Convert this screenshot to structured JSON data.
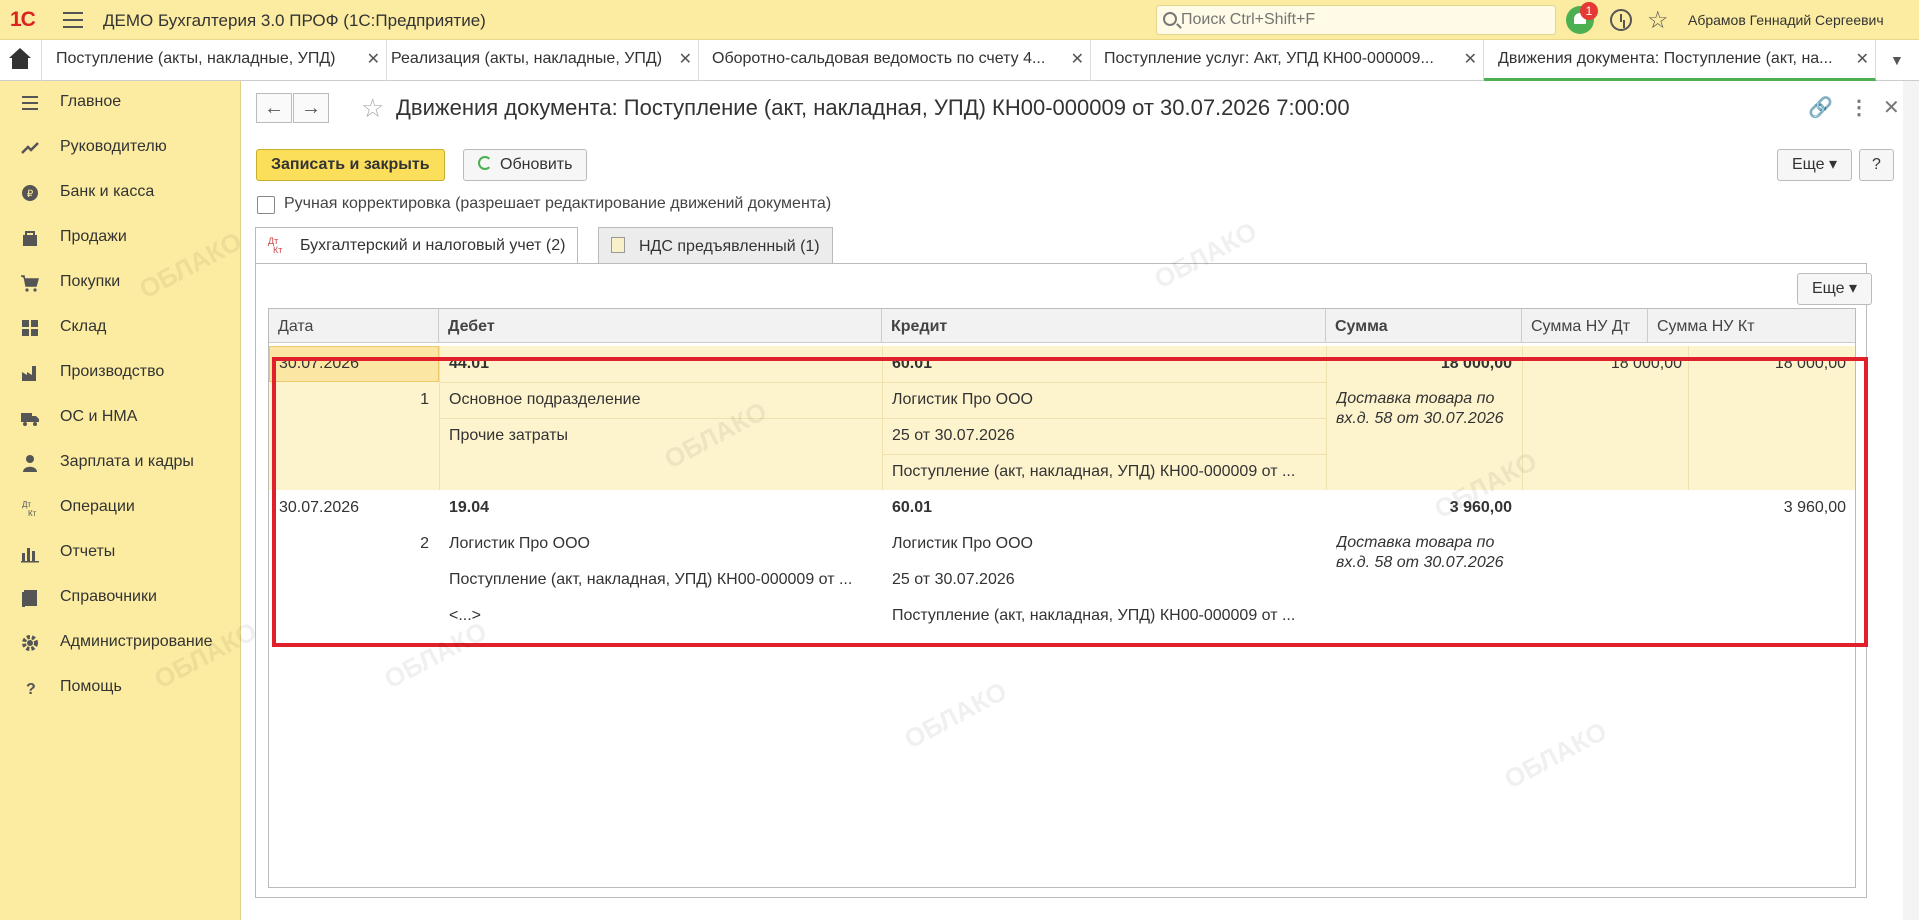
{
  "app": {
    "title": "ДЕМО Бухгалтерия 3.0 ПРОФ  (1С:Предприятие)",
    "search_placeholder": "Поиск Ctrl+Shift+F",
    "notifications": "1",
    "user": "Абрамов Геннадий Сергеевич"
  },
  "tabs": [
    {
      "label": "Поступление (акты, накладные, УПД)"
    },
    {
      "label": "Реализация (акты, накладные, УПД)"
    },
    {
      "label": "Оборотно-сальдовая ведомость по счету 4..."
    },
    {
      "label": "Поступление услуг: Акт, УПД КН00-000009..."
    },
    {
      "label": "Движения документа: Поступление (акт, на..."
    }
  ],
  "sidebar": {
    "items": [
      {
        "label": "Главное"
      },
      {
        "label": "Руководителю"
      },
      {
        "label": "Банк и касса"
      },
      {
        "label": "Продажи"
      },
      {
        "label": "Покупки"
      },
      {
        "label": "Склад"
      },
      {
        "label": "Производство"
      },
      {
        "label": "ОС и НМА"
      },
      {
        "label": "Зарплата и кадры"
      },
      {
        "label": "Операции"
      },
      {
        "label": "Отчеты"
      },
      {
        "label": "Справочники"
      },
      {
        "label": "Администрирование"
      },
      {
        "label": "Помощь"
      }
    ]
  },
  "document": {
    "title": "Движения документа: Поступление (акт, накладная, УПД) КН00-000009 от 30.07.2026 7:00:00",
    "save_close": "Записать и закрыть",
    "refresh": "Обновить",
    "more": "Еще",
    "help": "?",
    "manual_label": "Ручная корректировка (разрешает редактирование движений документа)",
    "form_tabs": [
      {
        "label": "Бухгалтерский и налоговый учет (2)"
      },
      {
        "label": "НДС предъявленный (1)"
      }
    ],
    "dtkt_icon": "Дт\nКт",
    "panel_more": "Еще"
  },
  "table": {
    "columns": [
      "Дата",
      "Дебет",
      "Кредит",
      "Сумма",
      "Сумма НУ Дт",
      "Сумма НУ Кт"
    ],
    "rows": [
      {
        "date": "30.07.2026",
        "num": "1",
        "debit": "44.01",
        "debit_sub": [
          "Основное подразделение",
          "Прочие затраты",
          ""
        ],
        "credit": "60.01",
        "credit_sub": [
          "Логистик Про ООО",
          "25 от 30.07.2026",
          "Поступление (акт, накладная, УПД) КН00-000009 от ..."
        ],
        "sum": "18 000,00",
        "content": "Доставка товара по вх.д. 58 от 30.07.2026",
        "nu_dt": "18 000,00",
        "nu_kt": "18 000,00"
      },
      {
        "date": "30.07.2026",
        "num": "2",
        "debit": "19.04",
        "debit_sub": [
          "Логистик Про ООО",
          "Поступление (акт, накладная, УПД) КН00-000009 от ...",
          "<...>"
        ],
        "credit": "60.01",
        "credit_sub": [
          "Логистик Про ООО",
          "25 от 30.07.2026",
          "Поступление (акт, накладная, УПД) КН00-000009 от ..."
        ],
        "sum": "3 960,00",
        "content": "Доставка товара по вх.д. 58 от 30.07.2026",
        "nu_dt": "",
        "nu_kt": "3 960,00"
      }
    ]
  },
  "watermark": "ОБЛАКО",
  "colors": {
    "accent_yellow": "#fbeca1",
    "primary_button": "#fbdf5b",
    "highlight": "#e0202a",
    "active_tab": "#4caf50"
  }
}
